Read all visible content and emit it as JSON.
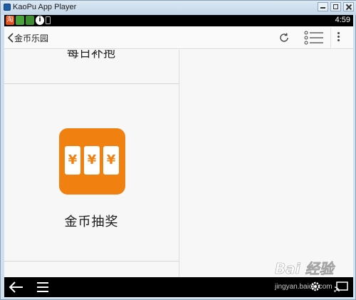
{
  "window": {
    "title": "KaoPu App Player"
  },
  "statusbar": {
    "icons": [
      "taobao-icon",
      "app-icon",
      "app-icon",
      "info-icon",
      "battery-icon"
    ],
    "taobao_glyph": "淘",
    "info_glyph": "i",
    "time": "4:59"
  },
  "appbar": {
    "title": "金币乐园"
  },
  "content": {
    "prev_item_label": "每日补抱",
    "lottery": {
      "slot_symbol": "¥",
      "label": "金币抽奖",
      "icon_color": "#f0800f"
    }
  },
  "watermark": {
    "logo": "Bai 经验",
    "url": "jingyan.baidu.com"
  },
  "colors": {
    "accent": "#f0800f",
    "statusbar": "#000000",
    "appbar": "#fafafa"
  }
}
